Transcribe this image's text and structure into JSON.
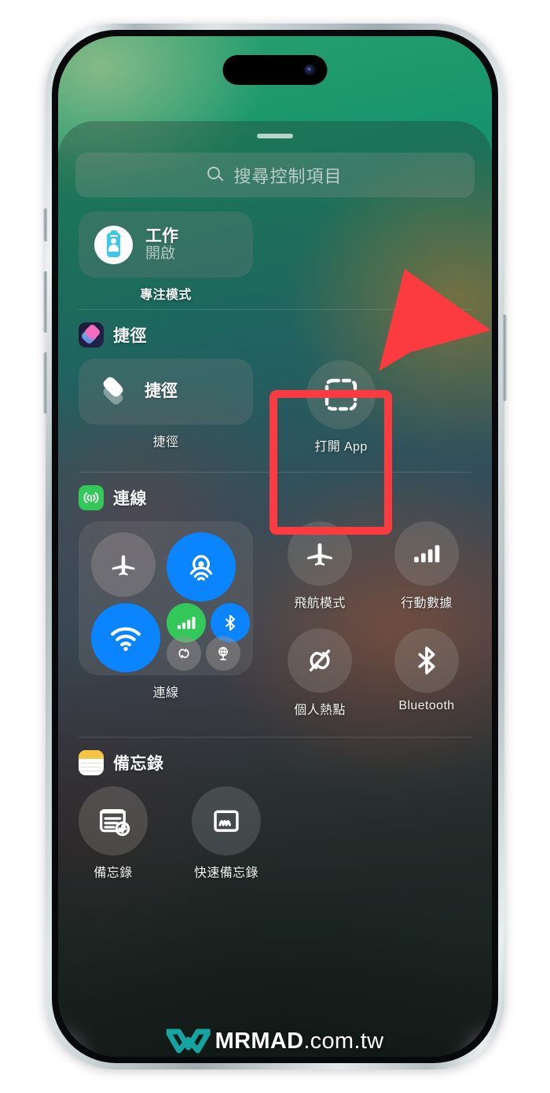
{
  "device": {
    "frame": "iphone-15-pro",
    "frame_color": "#c2cccf",
    "dynamic_island": true
  },
  "control_center": {
    "grabber": true,
    "search": {
      "icon": "search-icon",
      "placeholder": "搜尋控制項目",
      "value": ""
    },
    "sections": [
      {
        "id": "focus",
        "header": null,
        "controls": [
          {
            "type": "wide-tile",
            "icon": "focus-work-icon",
            "title": "工作",
            "subtitle": "開啟",
            "label": "專注模式",
            "state": "on"
          }
        ]
      },
      {
        "id": "shortcuts",
        "header": {
          "icon": "shortcuts-app-icon",
          "title": "捷徑"
        },
        "controls": [
          {
            "type": "wide-tile",
            "icon": "layers-icon",
            "title": "捷徑",
            "label": "捷徑"
          },
          {
            "type": "circle",
            "icon": "open-app-dashed-square-icon",
            "label": "打開 App",
            "highlighted": true
          }
        ]
      },
      {
        "id": "connectivity",
        "header": {
          "icon": "connectivity-antenna-icon",
          "title": "連線"
        },
        "controls": [
          {
            "type": "module",
            "label": "連線",
            "toggles": [
              {
                "name": "airplane-mode",
                "icon": "airplane-icon",
                "state": "off"
              },
              {
                "name": "airdrop",
                "icon": "airdrop-icon",
                "state": "on",
                "color": "#0a84ff"
              },
              {
                "name": "wifi",
                "icon": "wifi-icon",
                "state": "on",
                "color": "#0a84ff"
              },
              {
                "name": "cellular-data",
                "icon": "signal-bars-icon",
                "state": "on",
                "color": "#34c759"
              },
              {
                "name": "bluetooth",
                "icon": "bluetooth-icon",
                "state": "on",
                "color": "#0a84ff"
              },
              {
                "name": "personal-hotspot",
                "icon": "hotspot-icon",
                "state": "off"
              },
              {
                "name": "vpn",
                "icon": "vpn-globe-icon",
                "state": "off"
              }
            ]
          },
          {
            "type": "circle",
            "icon": "airplane-icon",
            "label": "飛航模式",
            "state": "off"
          },
          {
            "type": "circle",
            "icon": "signal-bars-icon",
            "label": "行動數據",
            "state": "off"
          },
          {
            "type": "circle",
            "icon": "hotspot-slash-icon",
            "label": "個人熱點",
            "state": "off"
          },
          {
            "type": "circle",
            "icon": "bluetooth-icon",
            "label": "Bluetooth",
            "state": "off"
          }
        ]
      },
      {
        "id": "notes",
        "header": {
          "icon": "notes-app-icon",
          "title": "備忘錄"
        },
        "controls": [
          {
            "type": "circle",
            "icon": "new-note-icon",
            "label": "備忘錄"
          },
          {
            "type": "circle",
            "icon": "quick-note-icon",
            "label": "快速備忘錄"
          }
        ]
      }
    ]
  },
  "annotations": {
    "highlight_box": {
      "color": "#fb3b40",
      "target": "打開 App"
    },
    "arrow": {
      "color": "#fb3b40",
      "points_to": "打開 App"
    }
  },
  "watermark": {
    "logo": "mrmad-logo-icon",
    "logo_color": "#17a3a0",
    "brand": "MRMAD",
    "domain": ".com.tw"
  },
  "colors": {
    "accent_blue": "#0a84ff",
    "accent_green": "#34c759",
    "highlight_red": "#fb3b40",
    "focus_cyan": "#3cc8e8"
  }
}
